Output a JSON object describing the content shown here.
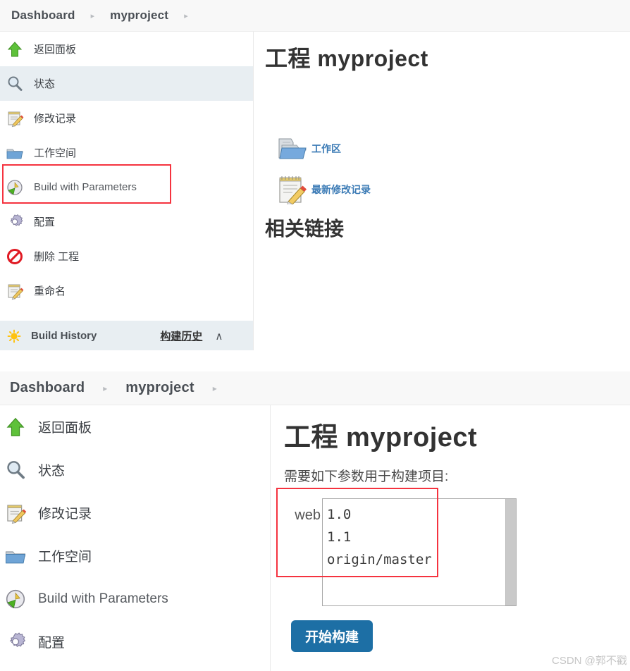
{
  "panels": [
    {
      "breadcrumb": {
        "items": [
          "Dashboard",
          "myproject"
        ],
        "separator": "▸"
      },
      "sidebar": {
        "items": [
          {
            "label": "返回面板",
            "icon": "up-arrow-icon",
            "selected": false,
            "lang": "zh"
          },
          {
            "label": "状态",
            "icon": "magnifier-icon",
            "selected": true,
            "lang": "zh"
          },
          {
            "label": "修改记录",
            "icon": "notepad-pencil-icon",
            "selected": false,
            "lang": "zh"
          },
          {
            "label": "工作空间",
            "icon": "folder-icon",
            "selected": false,
            "lang": "zh"
          },
          {
            "label": "Build with Parameters",
            "icon": "build-params-icon",
            "selected": false,
            "lang": "en"
          },
          {
            "label": "配置",
            "icon": "gear-icon",
            "selected": false,
            "lang": "zh"
          },
          {
            "label": "删除 工程",
            "icon": "delete-icon",
            "selected": false,
            "lang": "zh"
          },
          {
            "label": "重命名",
            "icon": "notepad-pencil-icon",
            "selected": false,
            "lang": "zh"
          }
        ],
        "build_history": {
          "label": "Build History",
          "icon": "sun-icon",
          "annotation": "构建历史",
          "chevron": "chevron-up-icon",
          "chevron_glyph": "∧"
        }
      },
      "main": {
        "title": "工程 myproject",
        "links": [
          {
            "label": "工作区",
            "icon": "folder-open-icon"
          },
          {
            "label": "最新修改记录",
            "icon": "notepad-pencil-icon"
          }
        ],
        "section_title": "相关链接"
      }
    },
    {
      "breadcrumb": {
        "items": [
          "Dashboard",
          "myproject"
        ],
        "separator": "▸"
      },
      "sidebar": {
        "items": [
          {
            "label": "返回面板",
            "icon": "up-arrow-icon",
            "selected": false,
            "lang": "zh"
          },
          {
            "label": "状态",
            "icon": "magnifier-icon",
            "selected": false,
            "lang": "zh"
          },
          {
            "label": "修改记录",
            "icon": "notepad-pencil-icon",
            "selected": false,
            "lang": "zh"
          },
          {
            "label": "工作空间",
            "icon": "folder-icon",
            "selected": false,
            "lang": "zh"
          },
          {
            "label": "Build with Parameters",
            "icon": "build-params-icon",
            "selected": false,
            "lang": "en"
          },
          {
            "label": "配置",
            "icon": "gear-icon",
            "selected": false,
            "lang": "zh"
          }
        ]
      },
      "main": {
        "title": "工程 myproject",
        "description": "需要如下参数用于构建项目:",
        "param": {
          "name": "web",
          "options": [
            "1.0",
            "1.1",
            "origin/master"
          ],
          "selected": null
        },
        "build_button": "开始构建"
      }
    }
  ],
  "watermark": "CSDN @郭不戳",
  "colors": {
    "accent_blue": "#1d6fa5",
    "link_blue": "#3a7ab5",
    "highlight_row": "#e8eef2",
    "annotation_red": "#f5333f",
    "crumb_bg": "#f8f8f8"
  }
}
